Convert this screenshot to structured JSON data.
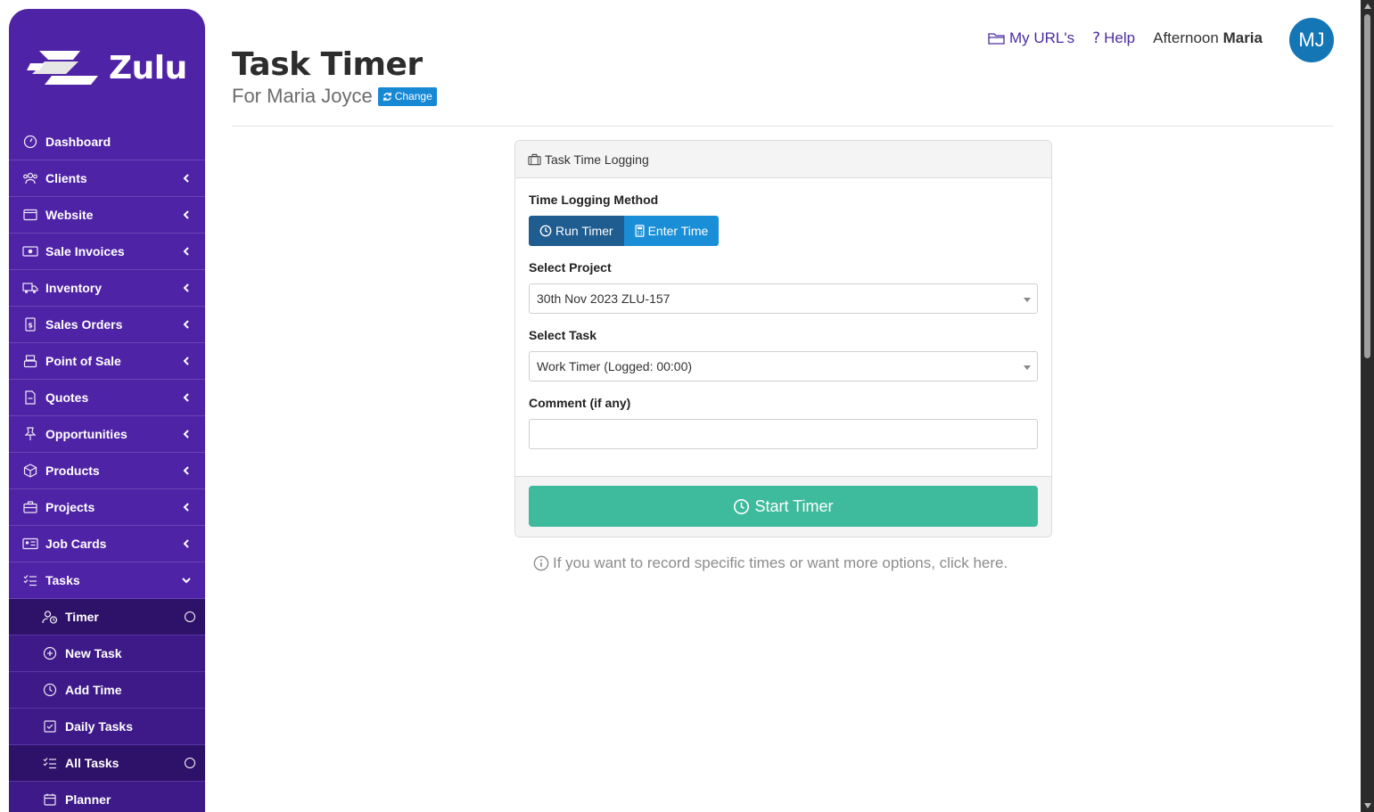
{
  "brand": {
    "name": "Zulu"
  },
  "colors": {
    "sidebar": "#4f23a6",
    "accent": "#1a8fd8",
    "start": "#3eba9c",
    "avatar": "#1576b6"
  },
  "sidebar": {
    "items": [
      {
        "label": "Dashboard",
        "icon": "dashboard-icon"
      },
      {
        "label": "Clients",
        "icon": "users-icon"
      },
      {
        "label": "Website",
        "icon": "browser-icon"
      },
      {
        "label": "Sale Invoices",
        "icon": "money-icon"
      },
      {
        "label": "Inventory",
        "icon": "truck-icon"
      },
      {
        "label": "Sales Orders",
        "icon": "receipt-icon"
      },
      {
        "label": "Point of Sale",
        "icon": "register-icon"
      },
      {
        "label": "Quotes",
        "icon": "quote-icon"
      },
      {
        "label": "Opportunities",
        "icon": "pin-icon"
      },
      {
        "label": "Products",
        "icon": "box-icon"
      },
      {
        "label": "Projects",
        "icon": "briefcase-icon"
      },
      {
        "label": "Job Cards",
        "icon": "id-card-icon"
      },
      {
        "label": "Tasks",
        "icon": "checklist-icon"
      }
    ],
    "tasks_sub": [
      {
        "label": "Timer",
        "icon": "user-clock-icon"
      },
      {
        "label": "New Task",
        "icon": "plus-circle-icon"
      },
      {
        "label": "Add Time",
        "icon": "clock-icon"
      },
      {
        "label": "Daily Tasks",
        "icon": "check-square-icon"
      },
      {
        "label": "All Tasks",
        "icon": "list-icon"
      },
      {
        "label": "Planner",
        "icon": "calendar-icon"
      }
    ]
  },
  "header": {
    "title": "Task Timer",
    "subtitle": "For Maria Joyce",
    "change_label": "Change",
    "my_urls": "My URL's",
    "help": "Help",
    "greeting_prefix": "Afternoon",
    "greeting_name": "Maria",
    "avatar_initials": "MJ"
  },
  "card": {
    "heading": "Task Time Logging",
    "method_label": "Time Logging Method",
    "run_timer": "Run Timer",
    "enter_time": "Enter Time",
    "project_label": "Select Project",
    "project_value": "30th Nov 2023 ZLU-157",
    "task_label": "Select Task",
    "task_value": "Work Timer (Logged: 00:00)",
    "comment_label": "Comment (if any)",
    "comment_value": "",
    "start_label": "Start Timer"
  },
  "hint": "If you want to record specific times or want more options, click here."
}
